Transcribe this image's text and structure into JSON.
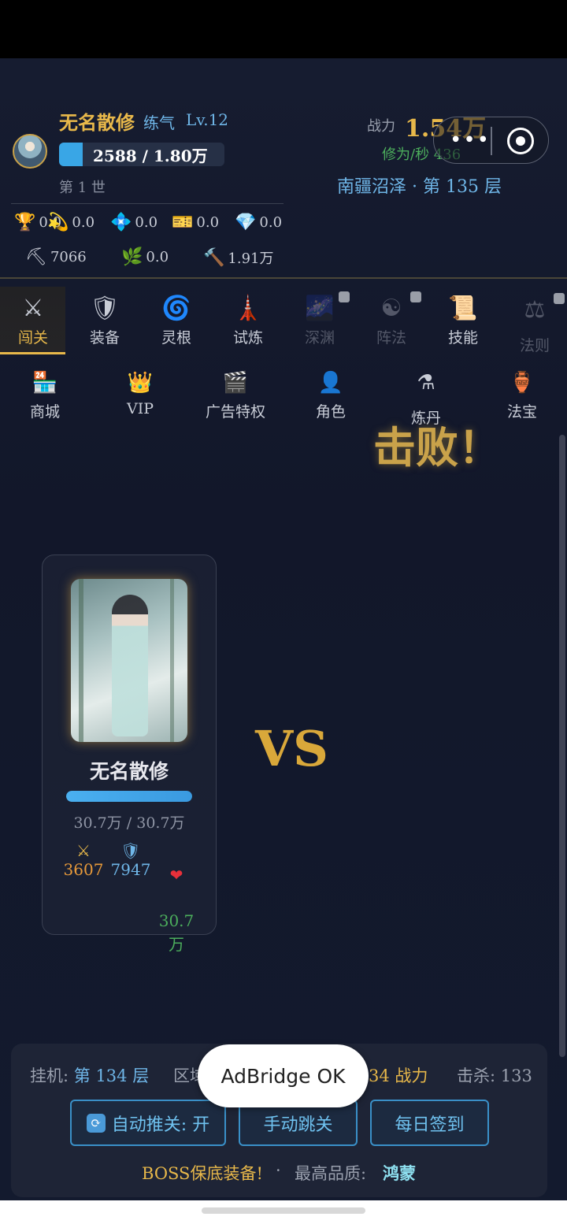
{
  "player": {
    "name": "无名散修",
    "realm": "练气",
    "level": "Lv.12",
    "exp_text": "2588 / 1.80万",
    "exp_fraction": 0.144,
    "generation": "第 1 世"
  },
  "combat": {
    "power_label": "战力",
    "power_value": "1.54万",
    "rate": "修为/秒 436",
    "zone": "南疆沼泽 · 第 135 层"
  },
  "resources": [
    {
      "icon": "trophy-icon",
      "glyph": "🏆",
      "value": "0.0"
    },
    {
      "icon": "swirl-icon",
      "glyph": "💫",
      "value": "0.0"
    },
    {
      "icon": "crystal-icon",
      "glyph": "💠",
      "value": "0.0"
    },
    {
      "icon": "ticket-icon",
      "glyph": "🎫",
      "value": "0.0"
    },
    {
      "icon": "diamond-icon",
      "glyph": "💎",
      "value": "0.0"
    },
    {
      "icon": "pickaxe-icon",
      "glyph": "⛏",
      "value": "7066"
    },
    {
      "icon": "herb-icon",
      "glyph": "🌿",
      "value": "0.0"
    },
    {
      "icon": "hammer-icon",
      "glyph": "🔨",
      "value": "1.91万"
    }
  ],
  "tabs_row1": [
    {
      "icon": "crossed-swords-icon",
      "glyph": "⚔",
      "label": "闯关",
      "active": true,
      "locked": false
    },
    {
      "icon": "shield-icon",
      "glyph": "🛡",
      "label": "装备",
      "active": false,
      "locked": false
    },
    {
      "icon": "spiral-icon",
      "glyph": "🌀",
      "label": "灵根",
      "active": false,
      "locked": false
    },
    {
      "icon": "tower-icon",
      "glyph": "🗼",
      "label": "试炼",
      "active": false,
      "locked": false
    },
    {
      "icon": "abyss-icon",
      "glyph": "🌌",
      "label": "深渊",
      "active": false,
      "locked": true
    },
    {
      "icon": "yin-yang-icon",
      "glyph": "☯",
      "label": "阵法",
      "active": false,
      "locked": true
    },
    {
      "icon": "scroll-icon",
      "glyph": "📜",
      "label": "技能",
      "active": false,
      "locked": false
    },
    {
      "icon": "scales-icon",
      "glyph": "⚖",
      "label": "法则",
      "active": false,
      "locked": true
    }
  ],
  "tabs_row2": [
    {
      "icon": "shop-icon",
      "glyph": "🏪",
      "label": "商城"
    },
    {
      "icon": "crown-icon",
      "glyph": "👑",
      "label": "VIP"
    },
    {
      "icon": "clapper-icon",
      "glyph": "🎬",
      "label": "广告特权"
    },
    {
      "icon": "character-icon",
      "glyph": "👤",
      "label": "角色"
    },
    {
      "icon": "flask-icon",
      "glyph": "⚗",
      "label": "炼丹"
    },
    {
      "icon": "vase-icon",
      "glyph": "🏺",
      "label": "法宝"
    }
  ],
  "battle": {
    "result": "击败！",
    "vs": "VS",
    "fighter_name": "无名散修",
    "hp_text": "30.7万 / 30.7万",
    "hp_fraction": 1.0,
    "attack": "3607",
    "defense": "7947",
    "hp": "30.7\n万"
  },
  "status": {
    "idle_label": "挂机:",
    "idle_value": "第 134 层",
    "region_label": "区域",
    "power_partial": "34 战力",
    "kills": "击杀: 133"
  },
  "buttons": {
    "auto": "自动推关: 开",
    "manual": "手动跳关",
    "checkin": "每日签到"
  },
  "footer": {
    "boss": "BOSS保底装备!",
    "dot": "·",
    "quality_label": "最高品质:",
    "quality_value": "鸿蒙"
  },
  "toast": "AdBridge OK"
}
